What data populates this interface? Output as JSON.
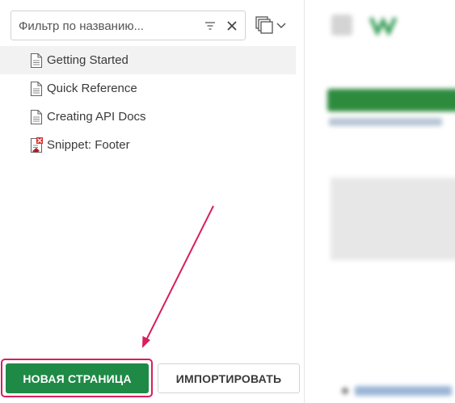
{
  "filter": {
    "placeholder": "Фильтр по названию..."
  },
  "icons": {
    "sort": "sort-lines-icon",
    "clear": "close-icon",
    "copy": "copy-pages-icon",
    "dropdown": "chevron-down-icon",
    "page": "document-icon",
    "snippet": "snippet-document-icon"
  },
  "pages": [
    {
      "label": "Getting Started",
      "selected": true,
      "type": "page"
    },
    {
      "label": "Quick Reference",
      "selected": false,
      "type": "page"
    },
    {
      "label": "Creating API Docs",
      "selected": false,
      "type": "page"
    },
    {
      "label": "Snippet: Footer",
      "selected": false,
      "type": "snippet"
    }
  ],
  "buttons": {
    "new_page": "НОВАЯ СТРАНИЦА",
    "import": "ИМПОРТИРОВАТЬ"
  },
  "annotation": {
    "color": "#d81e5b"
  },
  "colors": {
    "primary_button": "#1e8a46",
    "selected_row": "#f2f2f2"
  }
}
